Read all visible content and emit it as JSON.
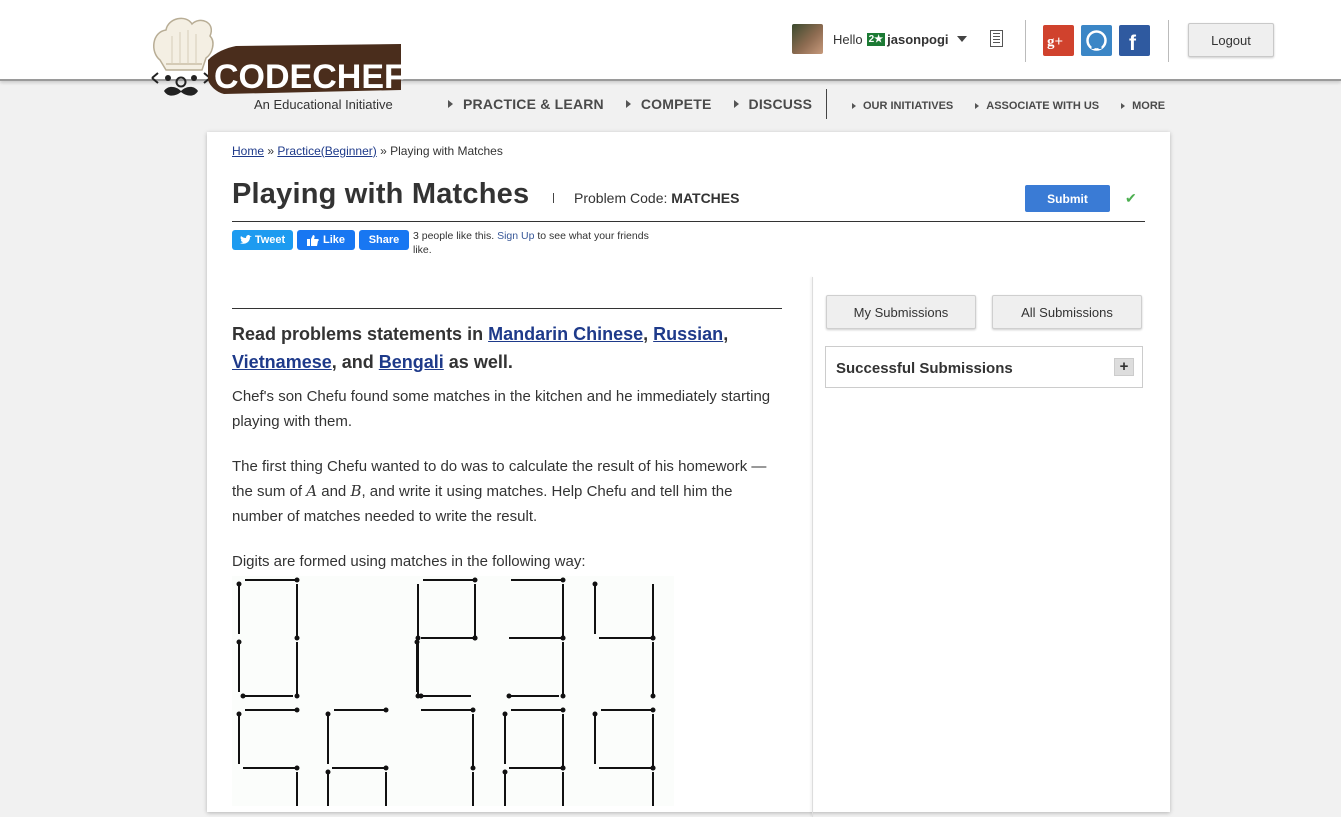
{
  "brand": {
    "name": "CODECHEF",
    "tagline": "An Educational Initiative"
  },
  "user": {
    "greeting": "Hello",
    "rating": "2★",
    "username": "jasonpogi"
  },
  "header": {
    "logout_label": "Logout"
  },
  "nav_main": [
    "PRACTICE & LEARN",
    "COMPETE",
    "DISCUSS"
  ],
  "nav_sub": [
    "OUR INITIATIVES",
    "ASSOCIATE WITH US",
    "MORE"
  ],
  "breadcrumb": {
    "home": "Home",
    "sep1": "»",
    "practice": "Practice(Beginner)",
    "sep2": "»",
    "current": "Playing with Matches"
  },
  "problem": {
    "title": "Playing with Matches",
    "code_label": "Problem Code:",
    "code": "MATCHES",
    "submit_label": "Submit"
  },
  "social": {
    "tweet": "Tweet",
    "like": "Like",
    "share": "Share",
    "likes_pre": "3 people like this.",
    "signup": "Sign Up",
    "likes_post": "to see what your friends like."
  },
  "statement": {
    "intro": "Read problems statements in",
    "lang1": "Mandarin Chinese",
    "comma1": ",",
    "lang2": "Russian",
    "comma2": ",",
    "lang3": "Vietnamese",
    "and": ", and",
    "lang4": "Bengali",
    "tail": "as well.",
    "p1": "Chef's son Chefu found some matches in the kitchen and he immediately starting playing with them.",
    "p2_a": "The first thing Chefu wanted to do was to calculate the result of his homework — the sum of",
    "var_a": "A",
    "p2_and": "and",
    "var_b": "B",
    "p2_b": ", and write it using matches. Help Chefu and tell him the number of matches needed to write the result.",
    "p3": "Digits are formed using matches in the following way:"
  },
  "sidebar": {
    "my_submissions": "My Submissions",
    "all_submissions": "All Submissions",
    "successful": "Successful Submissions",
    "expand": "+"
  },
  "colors": {
    "accent": "#3a7bd5",
    "link": "#1e3a8a",
    "brand_brown": "#4a2d1c",
    "check": "#4caf50"
  }
}
